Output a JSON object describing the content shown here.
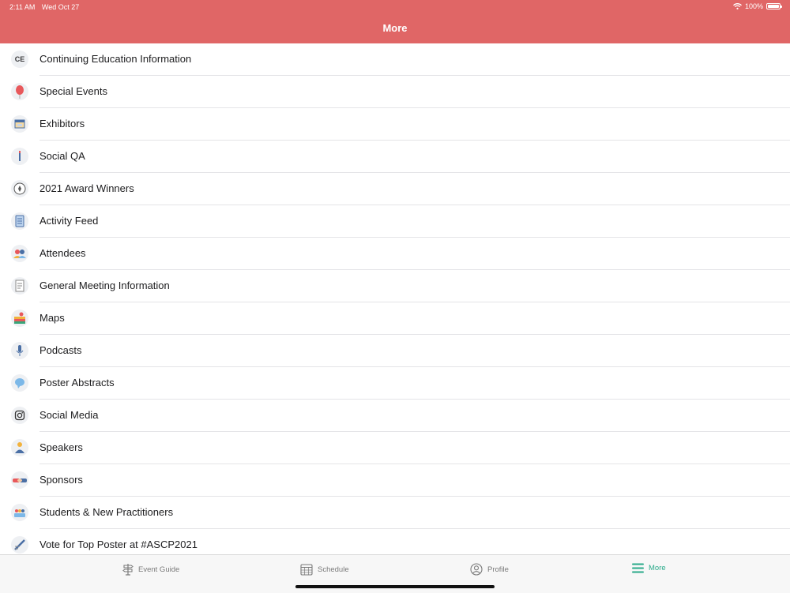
{
  "status_bar": {
    "time": "2:11 AM",
    "date": "Wed Oct 27",
    "battery": "100%"
  },
  "nav": {
    "title": "More"
  },
  "items": [
    {
      "label": "Continuing Education Information",
      "icon": "ce-icon"
    },
    {
      "label": "Special Events",
      "icon": "balloon-icon"
    },
    {
      "label": "Exhibitors",
      "icon": "booth-icon"
    },
    {
      "label": "Social QA",
      "icon": "pencil-icon"
    },
    {
      "label": "2021 Award Winners",
      "icon": "award-icon"
    },
    {
      "label": "Activity Feed",
      "icon": "feed-icon"
    },
    {
      "label": "Attendees",
      "icon": "attendees-icon"
    },
    {
      "label": "General Meeting Information",
      "icon": "document-icon"
    },
    {
      "label": "Maps",
      "icon": "map-icon"
    },
    {
      "label": "Podcasts",
      "icon": "microphone-icon"
    },
    {
      "label": "Poster Abstracts",
      "icon": "speech-bubble-icon"
    },
    {
      "label": "Social Media",
      "icon": "instagram-icon"
    },
    {
      "label": "Speakers",
      "icon": "speaker-icon"
    },
    {
      "label": "Sponsors",
      "icon": "handshake-icon"
    },
    {
      "label": "Students & New Practitioners",
      "icon": "students-icon"
    },
    {
      "label": "Vote for Top Poster at #ASCP2021",
      "icon": "vote-icon"
    }
  ],
  "ce_icon_text": "CE",
  "tabs": [
    {
      "label": "Event Guide",
      "icon": "signpost-icon"
    },
    {
      "label": "Schedule",
      "icon": "calendar-icon"
    },
    {
      "label": "Profile",
      "icon": "person-icon"
    },
    {
      "label": "More",
      "icon": "menu-icon",
      "active": true
    }
  ],
  "colors": {
    "header": "#e06666",
    "active_tab": "#2aaa8a"
  }
}
